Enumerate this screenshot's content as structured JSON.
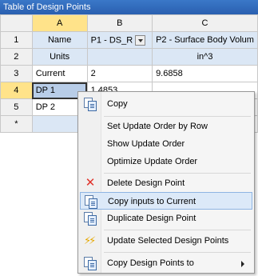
{
  "window": {
    "title": "Table of Design Points"
  },
  "columns": [
    "A",
    "B",
    "C"
  ],
  "header_row": {
    "num": "1",
    "name": "Name",
    "p1": "P1 - DS_R",
    "p2": "P2 - Surface Body Volum"
  },
  "units_row": {
    "num": "2",
    "name": "Units",
    "p1": "",
    "p2": "in^3"
  },
  "rows": [
    {
      "num": "3",
      "name": "Current",
      "p1": "2",
      "p2": "9.6858"
    },
    {
      "num": "4",
      "name": "DP 1",
      "p1": "1.4853",
      "p2": ""
    },
    {
      "num": "5",
      "name": "DP 2",
      "p1": "",
      "p2": ""
    },
    {
      "num": "*",
      "name": "",
      "p1": "",
      "p2": ""
    }
  ],
  "context_menu": {
    "items": [
      {
        "label": "Copy",
        "icon": "copy-icon"
      },
      {
        "label": "Set Update Order by Row",
        "icon": ""
      },
      {
        "label": "Show Update Order",
        "icon": ""
      },
      {
        "label": "Optimize Update Order",
        "icon": ""
      },
      {
        "label": "Delete Design Point",
        "icon": "delete-icon"
      },
      {
        "label": "Copy inputs to Current",
        "icon": "copy-icon"
      },
      {
        "label": "Duplicate Design Point",
        "icon": "copy-icon"
      },
      {
        "label": "Update Selected Design Points",
        "icon": "lightning-icon"
      },
      {
        "label": "Copy Design Points to",
        "icon": "copy-icon"
      }
    ],
    "highlighted": "Copy inputs to Current"
  },
  "colors": {
    "title_bar": "#2f6bbd",
    "highlight": "#dce9f8",
    "selected_header": "#ffe38a"
  }
}
